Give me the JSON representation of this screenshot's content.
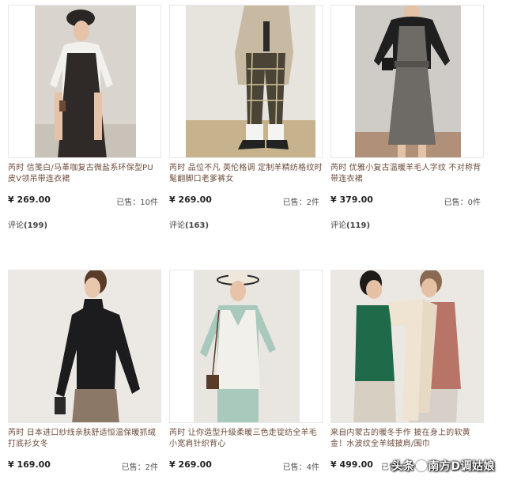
{
  "products": [
    {
      "title": "芮时 信笺白/马革咖复古微盐系环保型PU皮V领吊带连衣裙",
      "price": "¥ 269.00",
      "sold": "已售：10件",
      "comments_label": "评论",
      "comments_count": "(199)",
      "image_name": "black-slip-dress-photo"
    },
    {
      "title": "芮时 品位不凡 英伦格调 定制羊精纺格纹时髦翻脚口老爹裤女",
      "price": "¥ 269.00",
      "sold": "已售：2件",
      "comments_label": "评论",
      "comments_count": "(163)",
      "image_name": "plaid-trousers-photo"
    },
    {
      "title": "芮时 优雅小复古温暖羊毛人字纹 不对称背带连衣裙",
      "price": "¥ 379.00",
      "sold": "已售：0件",
      "comments_label": "评论",
      "comments_count": "(119)",
      "image_name": "herringbone-pinafore-photo"
    },
    {
      "title": "芮时 日本进口纱线亲肤舒适恒温保暖抓绒打底衫女冬",
      "price": "¥ 169.00",
      "sold": "已售：2件",
      "image_name": "black-turtleneck-photo"
    },
    {
      "title": "芮时 让你造型升级柔暖三色走锭纺全羊毛小宽肩针织背心",
      "price": "¥ 269.00",
      "sold": "已售：4件",
      "image_name": "knit-vest-photo"
    },
    {
      "title": "来自内蒙古的暖冬手作 披在身上的软黄金！水波纹全羊绒披肩/围巾",
      "price": "¥ 499.00",
      "sold": "已售：",
      "image_name": "cashmere-scarf-photo"
    }
  ],
  "watermark": {
    "prefix": "头条",
    "suffix": "南方D调姑娘"
  }
}
